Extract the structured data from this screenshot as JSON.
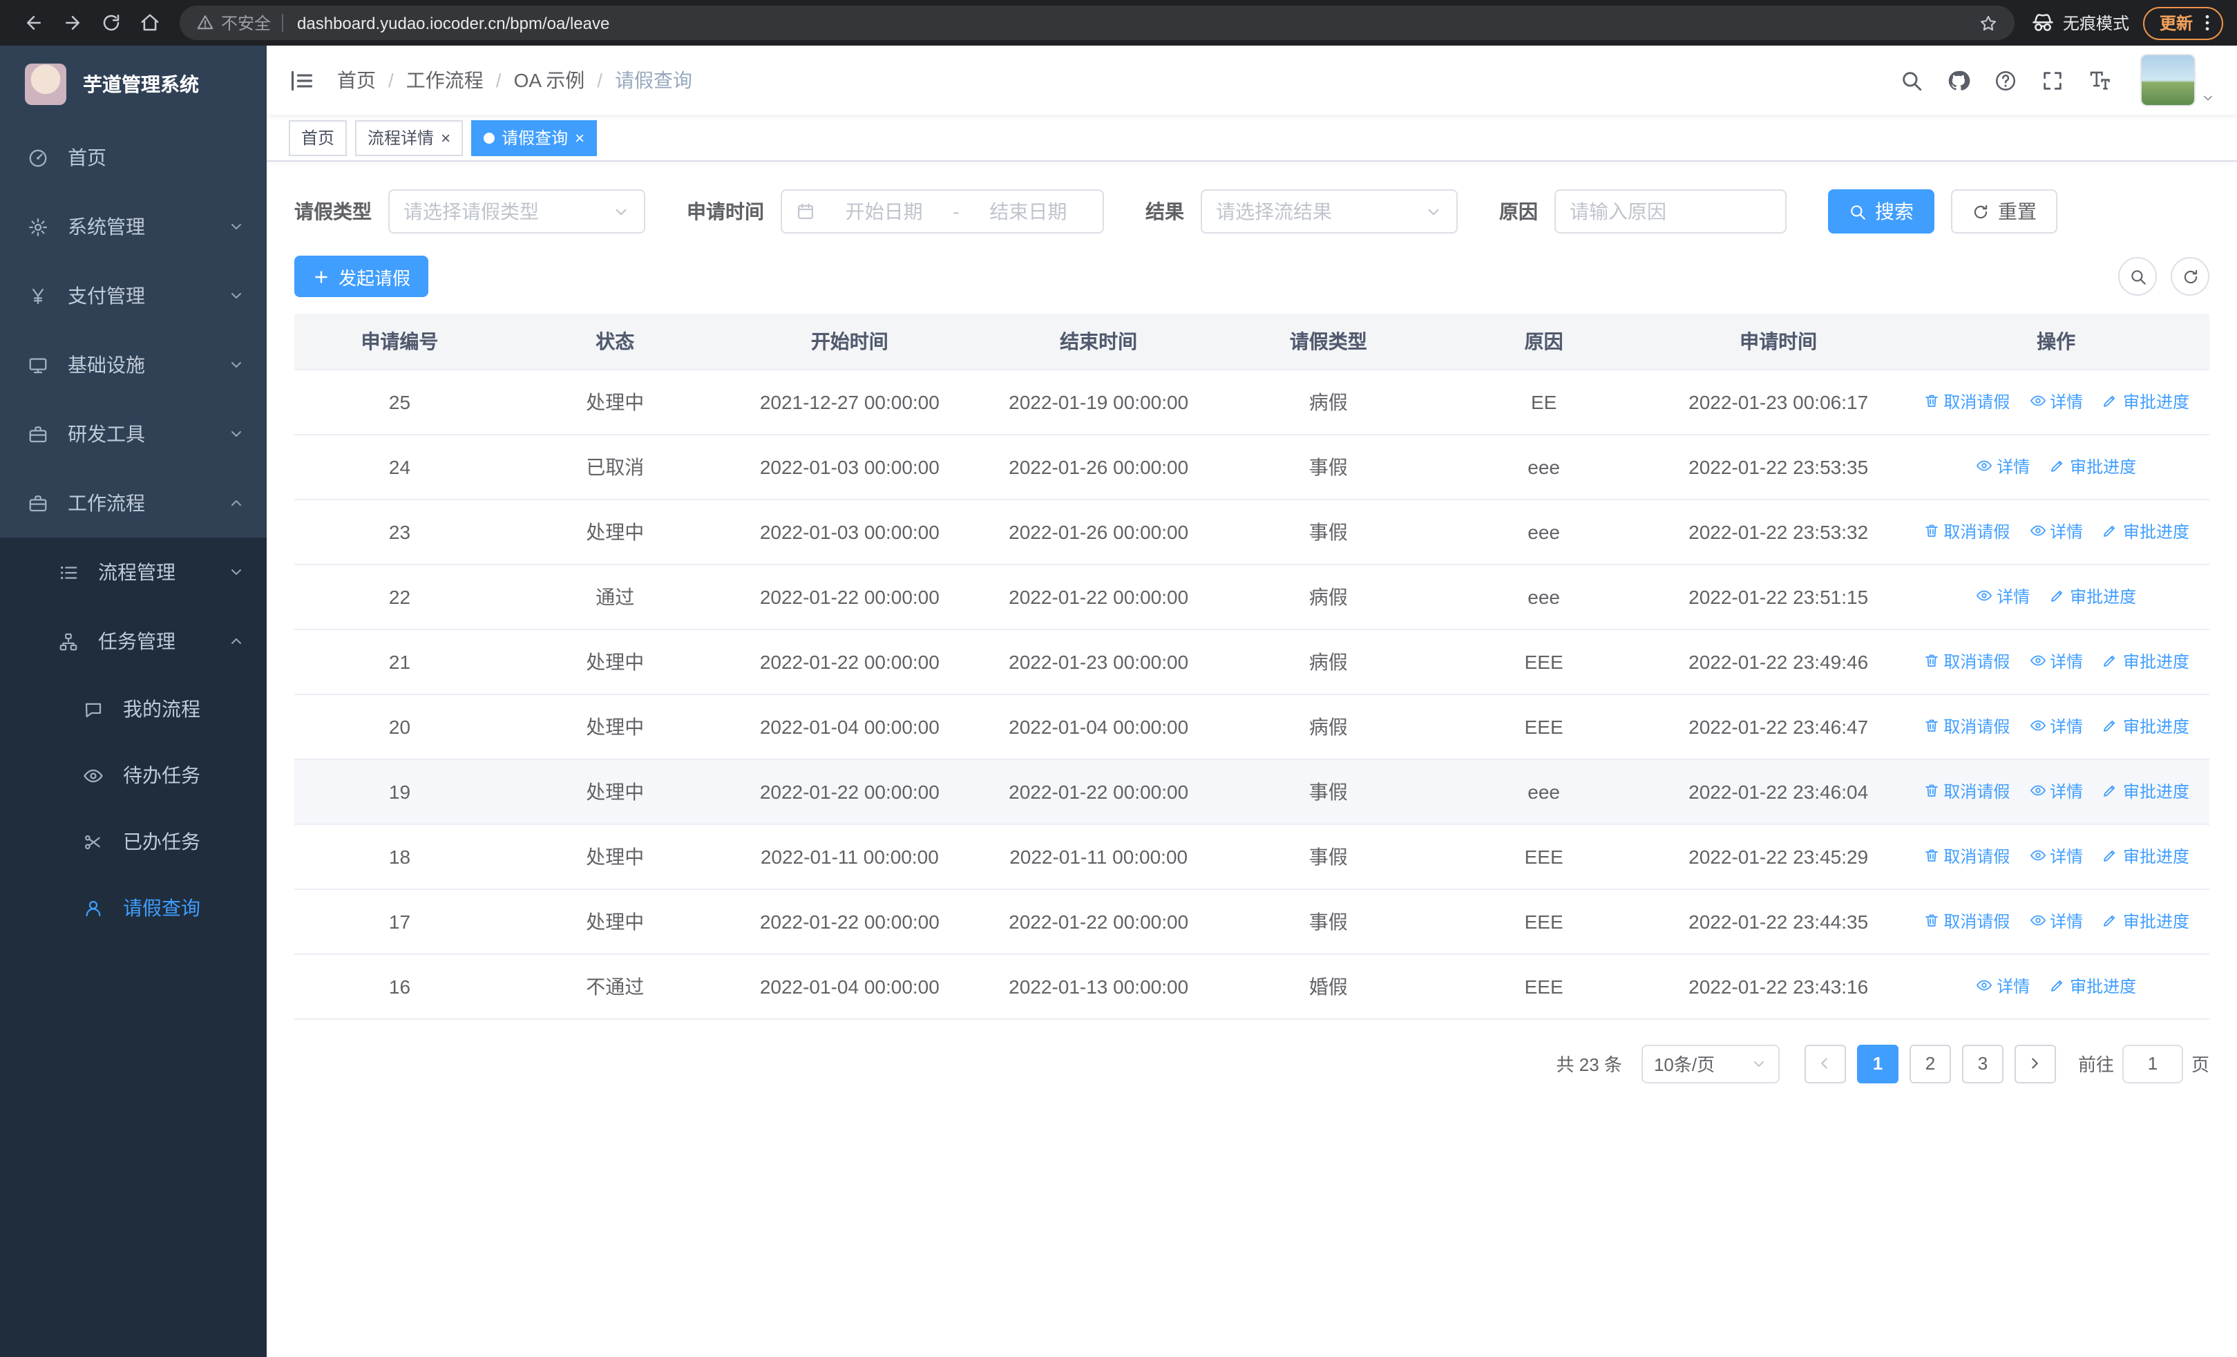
{
  "browser": {
    "security_warning": "不安全",
    "url": "dashboard.yudao.iocoder.cn/bpm/oa/leave",
    "incognito_label": "无痕模式",
    "update_label": "更新"
  },
  "sidebar": {
    "logo_title": "芋道管理系统",
    "items": [
      {
        "label": "首页",
        "icon": "dashboard-icon"
      },
      {
        "label": "系统管理",
        "icon": "gear-icon"
      },
      {
        "label": "支付管理",
        "icon": "yen-icon"
      },
      {
        "label": "基础设施",
        "icon": "monitor-icon"
      },
      {
        "label": "研发工具",
        "icon": "briefcase-icon"
      },
      {
        "label": "工作流程",
        "icon": "briefcase-icon"
      },
      {
        "label": "流程管理",
        "icon": "list-icon"
      },
      {
        "label": "任务管理",
        "icon": "flow-icon"
      },
      {
        "label": "我的流程",
        "icon": "chat-icon"
      },
      {
        "label": "待办任务",
        "icon": "eye-icon"
      },
      {
        "label": "已办任务",
        "icon": "scissors-icon"
      },
      {
        "label": "请假查询",
        "icon": "user-icon"
      }
    ]
  },
  "breadcrumb": [
    "首页",
    "工作流程",
    "OA 示例",
    "请假查询"
  ],
  "tabs": [
    {
      "label": "首页"
    },
    {
      "label": "流程详情"
    },
    {
      "label": "请假查询"
    }
  ],
  "filters": {
    "leave_type_label": "请假类型",
    "leave_type_placeholder": "请选择请假类型",
    "apply_time_label": "申请时间",
    "start_date_placeholder": "开始日期",
    "date_separator": "-",
    "end_date_placeholder": "结束日期",
    "result_label": "结果",
    "result_placeholder": "请选择流结果",
    "reason_label": "原因",
    "reason_placeholder": "请输入原因",
    "search_label": "搜索",
    "reset_label": "重置"
  },
  "toolbar": {
    "create_label": "发起请假"
  },
  "table": {
    "columns": [
      "申请编号",
      "状态",
      "开始时间",
      "结束时间",
      "请假类型",
      "原因",
      "申请时间",
      "操作"
    ],
    "actions": {
      "cancel": "取消请假",
      "detail": "详情",
      "progress": "审批进度"
    },
    "rows": [
      {
        "id": "25",
        "status": "处理中",
        "start": "2021-12-27 00:00:00",
        "end": "2022-01-19 00:00:00",
        "type": "病假",
        "reason": "EE",
        "time": "2022-01-23 00:06:17",
        "cancellable": true
      },
      {
        "id": "24",
        "status": "已取消",
        "start": "2022-01-03 00:00:00",
        "end": "2022-01-26 00:00:00",
        "type": "事假",
        "reason": "eee",
        "time": "2022-01-22 23:53:35",
        "cancellable": false
      },
      {
        "id": "23",
        "status": "处理中",
        "start": "2022-01-03 00:00:00",
        "end": "2022-01-26 00:00:00",
        "type": "事假",
        "reason": "eee",
        "time": "2022-01-22 23:53:32",
        "cancellable": true
      },
      {
        "id": "22",
        "status": "通过",
        "start": "2022-01-22 00:00:00",
        "end": "2022-01-22 00:00:00",
        "type": "病假",
        "reason": "eee",
        "time": "2022-01-22 23:51:15",
        "cancellable": false
      },
      {
        "id": "21",
        "status": "处理中",
        "start": "2022-01-22 00:00:00",
        "end": "2022-01-23 00:00:00",
        "type": "病假",
        "reason": "EEE",
        "time": "2022-01-22 23:49:46",
        "cancellable": true
      },
      {
        "id": "20",
        "status": "处理中",
        "start": "2022-01-04 00:00:00",
        "end": "2022-01-04 00:00:00",
        "type": "病假",
        "reason": "EEE",
        "time": "2022-01-22 23:46:47",
        "cancellable": true
      },
      {
        "id": "19",
        "status": "处理中",
        "start": "2022-01-22 00:00:00",
        "end": "2022-01-22 00:00:00",
        "type": "事假",
        "reason": "eee",
        "time": "2022-01-22 23:46:04",
        "cancellable": true
      },
      {
        "id": "18",
        "status": "处理中",
        "start": "2022-01-11 00:00:00",
        "end": "2022-01-11 00:00:00",
        "type": "事假",
        "reason": "EEE",
        "time": "2022-01-22 23:45:29",
        "cancellable": true
      },
      {
        "id": "17",
        "status": "处理中",
        "start": "2022-01-22 00:00:00",
        "end": "2022-01-22 00:00:00",
        "type": "事假",
        "reason": "EEE",
        "time": "2022-01-22 23:44:35",
        "cancellable": true
      },
      {
        "id": "16",
        "status": "不通过",
        "start": "2022-01-04 00:00:00",
        "end": "2022-01-13 00:00:00",
        "type": "婚假",
        "reason": "EEE",
        "time": "2022-01-22 23:43:16",
        "cancellable": false
      }
    ]
  },
  "pagination": {
    "total": "共 23 条",
    "page_size": "10条/页",
    "pages": [
      "1",
      "2",
      "3"
    ],
    "active_page": "1",
    "goto_label": "前往",
    "goto_value": "1",
    "page_unit": "页"
  },
  "colors": {
    "accent": "#409eff",
    "sidebar_bg": "#304156",
    "submenu_bg": "#1f2d3d",
    "chrome_bg": "#202124",
    "update_pill": "#ee9446"
  }
}
